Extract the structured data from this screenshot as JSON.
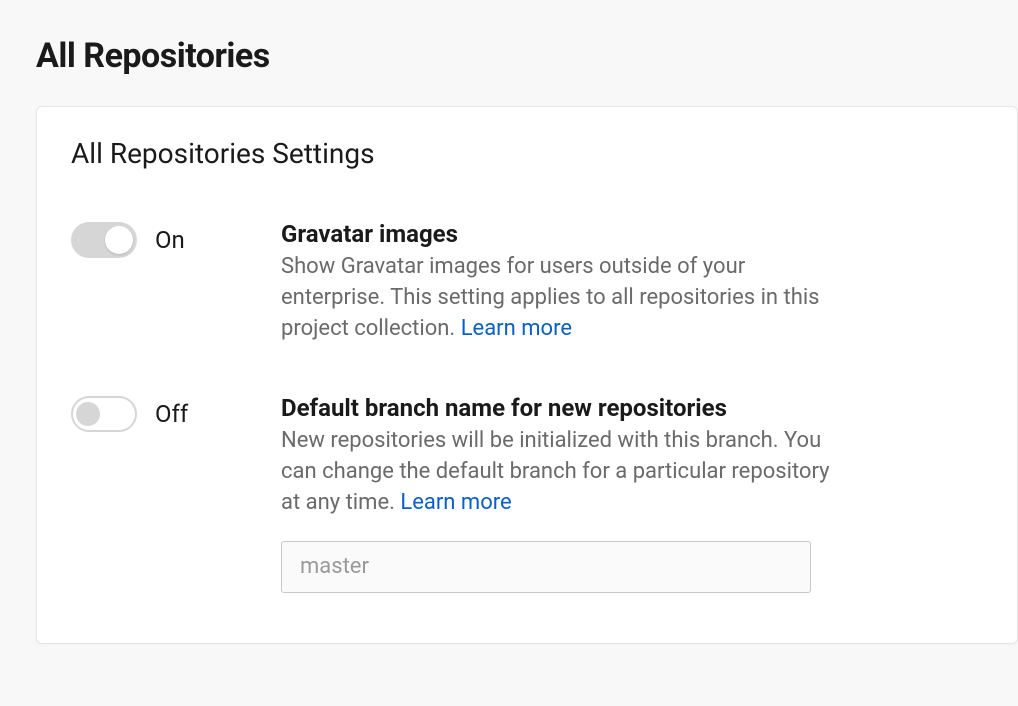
{
  "page": {
    "title": "All Repositories"
  },
  "card": {
    "title": "All Repositories Settings"
  },
  "settings": {
    "gravatar": {
      "toggle_state": "On",
      "title": "Gravatar images",
      "description": "Show Gravatar images for users outside of your enterprise. This setting applies to all repositories in this project collection. ",
      "learn_more": "Learn more"
    },
    "default_branch": {
      "toggle_state": "Off",
      "title": "Default branch name for new repositories",
      "description": "New repositories will be initialized with this branch. You can change the default branch for a particular repository at any time. ",
      "learn_more": "Learn more",
      "input_placeholder": "master",
      "input_value": ""
    }
  }
}
